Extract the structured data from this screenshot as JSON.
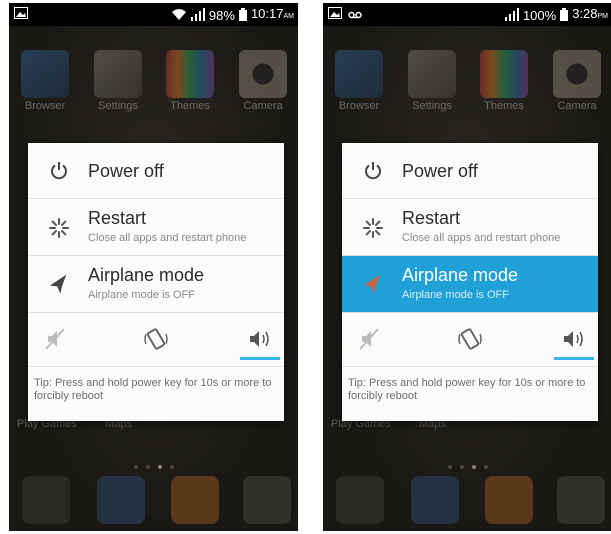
{
  "screens": [
    {
      "status": {
        "battery": "98%",
        "time": "10:17",
        "ampm": "AM"
      },
      "apps": [
        "Browser",
        "Settings",
        "Themes",
        "Camera"
      ],
      "bottom_labels": [
        "Play Games",
        "Maps"
      ],
      "dialog": {
        "power_off": "Power off",
        "restart": "Restart",
        "restart_sub": "Close all apps and restart phone",
        "airplane": "Airplane mode",
        "airplane_sub": "Airplane mode is OFF",
        "airplane_highlighted": false,
        "selected_sound_mode": "sound",
        "tip": "Tip: Press and hold power key for 10s or more to forcibly reboot"
      }
    },
    {
      "status": {
        "battery": "100%",
        "time": "3:28",
        "ampm": "PM"
      },
      "apps": [
        "Browser",
        "Settings",
        "Themes",
        "Camera"
      ],
      "bottom_labels": [
        "Play Games",
        "Maps"
      ],
      "dialog": {
        "power_off": "Power off",
        "restart": "Restart",
        "restart_sub": "Close all apps and restart phone",
        "airplane": "Airplane mode",
        "airplane_sub": "Airplane mode is OFF",
        "airplane_highlighted": true,
        "selected_sound_mode": "sound",
        "tip": "Tip: Press and hold power key for 10s or more to forcibly reboot"
      }
    }
  ],
  "colors": {
    "highlight": "#1fa0d6",
    "underline": "#37b5e6",
    "dialog_bg": "#fbfbfb"
  },
  "icons": [
    "gallery-icon",
    "wifi-icon",
    "signal-icon",
    "battery-icon",
    "voicemail-icon",
    "power-icon",
    "restart-icon",
    "airplane-icon",
    "mute-icon",
    "vibrate-icon",
    "sound-icon"
  ]
}
